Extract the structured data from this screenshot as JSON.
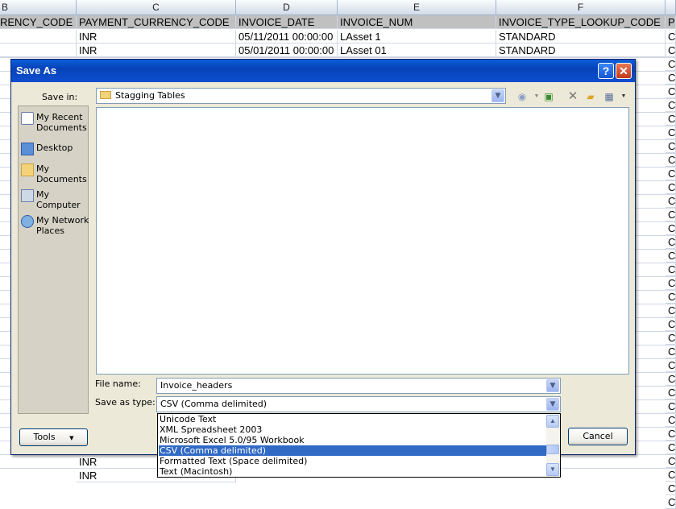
{
  "sheet": {
    "columns": [
      "B",
      "C",
      "D",
      "E",
      "F"
    ],
    "headers": [
      "RENCY_CODE",
      "PAYMENT_CURRENCY_CODE",
      "INVOICE_DATE",
      "INVOICE_NUM",
      "INVOICE_TYPE_LOOKUP_CODE",
      "P"
    ],
    "row1": [
      "INR",
      "05/11/2011 00:00:00",
      "LAsset 1",
      "STANDARD",
      "C"
    ],
    "row2": [
      "INR",
      "05/01/2011 00:00:00",
      "LAsset 01",
      "STANDARD",
      "C"
    ],
    "bottom_rows": [
      "INR",
      "INR"
    ],
    "right_col": [
      "C",
      "C",
      "C",
      "C",
      "C",
      "C",
      "C",
      "C",
      "C",
      "C",
      "C",
      "C",
      "C",
      "C",
      "C",
      "C",
      "C",
      "C",
      "C",
      "C",
      "C",
      "C",
      "C",
      "C",
      "C",
      "C",
      "C",
      "C",
      "C",
      "C",
      "C",
      "C",
      "C"
    ]
  },
  "dialog": {
    "title": "Save As",
    "help_label": "?",
    "close_label": "✕",
    "save_in_label": "Save in:",
    "save_in_value": "Stagging Tables",
    "places": [
      "My Recent Documents",
      "Desktop",
      "My Documents",
      "My Computer",
      "My Network Places"
    ],
    "file_name_label": "File name:",
    "file_name_value": "Invoice_headers",
    "save_type_label": "Save as type:",
    "save_type_value": "CSV (Comma delimited)",
    "type_options": [
      "Unicode Text",
      "XML Spreadsheet 2003",
      "Microsoft Excel 5.0/95 Workbook",
      "CSV (Comma delimited)",
      "Formatted Text (Space delimited)",
      "Text (Macintosh)"
    ],
    "selected_option_index": 3,
    "tools_label": "Tools",
    "cancel_label": "Cancel"
  }
}
